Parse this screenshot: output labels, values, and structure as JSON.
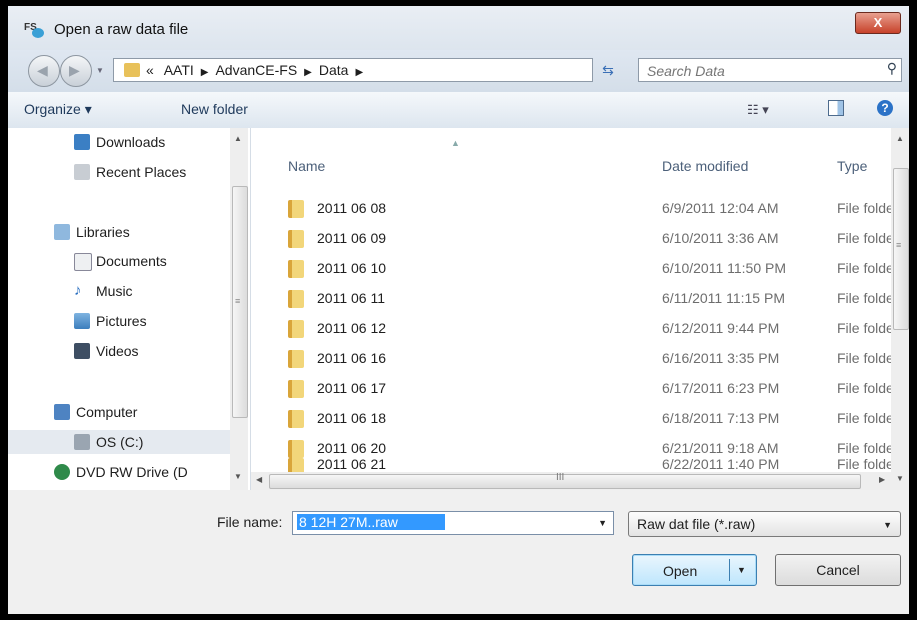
{
  "window": {
    "title": "Open a raw data file",
    "app_icon_label": "FS",
    "close_glyph": "X"
  },
  "address": {
    "overflow_glyph": "«",
    "crumbs": [
      "AATI",
      "AdvanCE-FS",
      "Data"
    ],
    "search_placeholder": "Search Data"
  },
  "toolbar": {
    "organize_label": "Organize ▾",
    "new_folder_label": "New folder"
  },
  "navpane": {
    "items": [
      {
        "label": "Downloads",
        "icon": "downloads-icon"
      },
      {
        "label": "Recent Places",
        "icon": "recent-places-icon"
      },
      {
        "label": "Libraries",
        "icon": "libraries-icon"
      },
      {
        "label": "Documents",
        "icon": "documents-icon"
      },
      {
        "label": "Music",
        "icon": "music-icon"
      },
      {
        "label": "Pictures",
        "icon": "pictures-icon"
      },
      {
        "label": "Videos",
        "icon": "videos-icon"
      },
      {
        "label": "Computer",
        "icon": "computer-icon"
      },
      {
        "label": "OS (C:)",
        "icon": "drive-icon"
      },
      {
        "label": "DVD RW Drive (D",
        "icon": "dvd-drive-icon"
      }
    ],
    "selected": "OS (C:)"
  },
  "columns": {
    "name": "Name",
    "date": "Date modified",
    "type": "Type"
  },
  "files": [
    {
      "name": "2011 06 08",
      "date": "6/9/2011 12:04 AM",
      "type": "File folde"
    },
    {
      "name": "2011 06 09",
      "date": "6/10/2011 3:36 AM",
      "type": "File folde"
    },
    {
      "name": "2011 06 10",
      "date": "6/10/2011 11:50 PM",
      "type": "File folde"
    },
    {
      "name": "2011 06 11",
      "date": "6/11/2011 11:15 PM",
      "type": "File folde"
    },
    {
      "name": "2011 06 12",
      "date": "6/12/2011 9:44 PM",
      "type": "File folde"
    },
    {
      "name": "2011 06 16",
      "date": "6/16/2011 3:35 PM",
      "type": "File folde"
    },
    {
      "name": "2011 06 17",
      "date": "6/17/2011 6:23 PM",
      "type": "File folde"
    },
    {
      "name": "2011 06 18",
      "date": "6/18/2011 7:13 PM",
      "type": "File folde"
    },
    {
      "name": "2011 06 20",
      "date": "6/21/2011 9:18 AM",
      "type": "File folde"
    },
    {
      "name": "2011 06 21",
      "date": "6/22/2011 1:40 PM",
      "type": "File folde"
    }
  ],
  "bottom": {
    "file_name_label": "File name:",
    "file_name_value": "8 12H 27M..raw",
    "file_type_value": "Raw dat file (*.raw)",
    "open_label": "Open",
    "cancel_label": "Cancel"
  },
  "colors": {
    "accent": "#3399ff",
    "folder": "#e8c15a",
    "close": "#c7422a"
  }
}
